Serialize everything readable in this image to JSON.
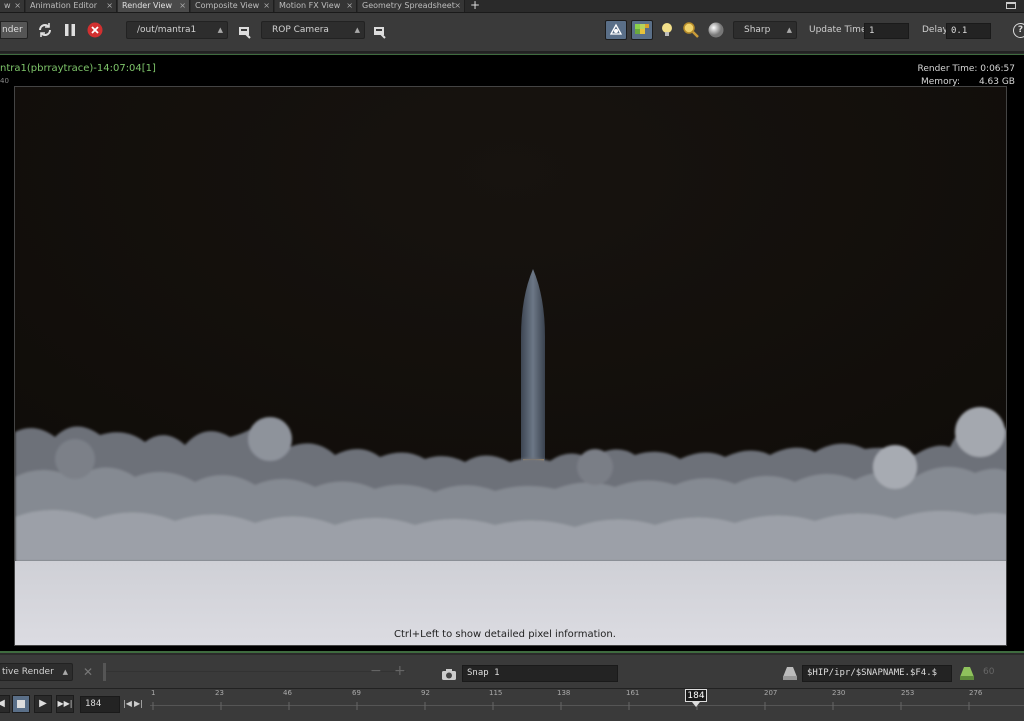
{
  "tabs": [
    {
      "label": "w"
    },
    {
      "label": "Animation Editor"
    },
    {
      "label": "Render View",
      "active": true
    },
    {
      "label": "Composite View"
    },
    {
      "label": "Motion FX View"
    },
    {
      "label": "Geometry Spreadsheet"
    }
  ],
  "tab_add": "+",
  "toolbar": {
    "render_button": "nder",
    "output_path": "/out/mantra1",
    "camera": "ROP Camera",
    "filter": "Sharp",
    "update_time_label": "Update Time",
    "update_time_value": "1",
    "delay_label": "Delay",
    "delay_value": "0.1",
    "help": "?"
  },
  "render_info": {
    "title": "ntra1(pbrraytrace)-14:07:04[1]",
    "sub": "40",
    "render_time": "Render Time: 0:06:57",
    "memory_label": "Memory:",
    "memory_value": "4.63 GB",
    "hint": "Ctrl+Left to show detailed pixel information."
  },
  "snap_bar": {
    "mode": "tive Render",
    "snap_name": "Snap 1",
    "snap_path": "$HIP/ipr/$SNAPNAME.$F4.$",
    "frame_count": "60"
  },
  "playbar": {
    "current_frame": "184",
    "marker": "184",
    "ticks": [
      "1",
      "23",
      "46",
      "69",
      "92",
      "115",
      "138",
      "161",
      "207",
      "230",
      "253",
      "276"
    ]
  },
  "colors": {
    "accent_green": "#3f6b3f",
    "title_green": "#7ec46a",
    "stop_red": "#d23030"
  }
}
